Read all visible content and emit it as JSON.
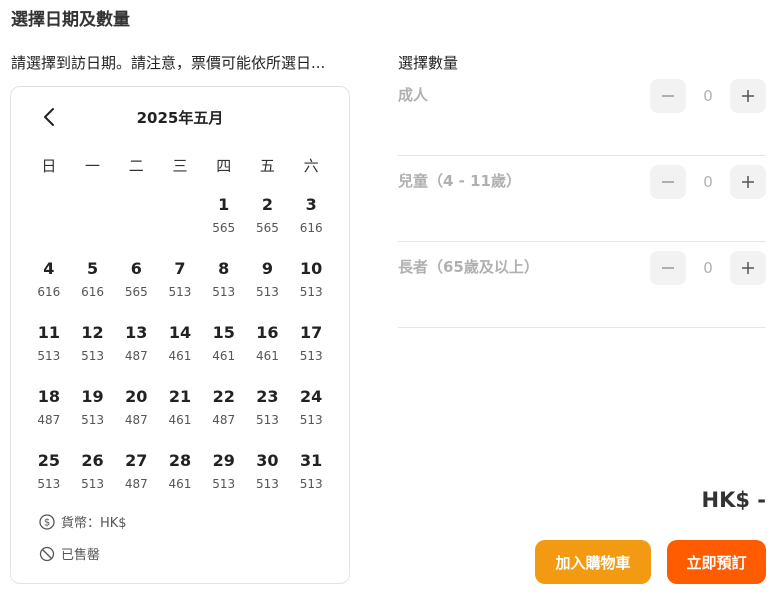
{
  "title": "選擇日期及數量",
  "date_prompt": "請選擇到訪日期。請注意，票價可能依所選日...",
  "calendar": {
    "month_label": "2025年五月",
    "weekdays": [
      "日",
      "一",
      "二",
      "三",
      "四",
      "五",
      "六"
    ],
    "leading_blanks": 4,
    "days": [
      {
        "day": "1",
        "price": "565"
      },
      {
        "day": "2",
        "price": "565"
      },
      {
        "day": "3",
        "price": "616"
      },
      {
        "day": "4",
        "price": "616"
      },
      {
        "day": "5",
        "price": "616"
      },
      {
        "day": "6",
        "price": "565"
      },
      {
        "day": "7",
        "price": "513"
      },
      {
        "day": "8",
        "price": "513"
      },
      {
        "day": "9",
        "price": "513"
      },
      {
        "day": "10",
        "price": "513"
      },
      {
        "day": "11",
        "price": "513"
      },
      {
        "day": "12",
        "price": "513"
      },
      {
        "day": "13",
        "price": "487"
      },
      {
        "day": "14",
        "price": "461"
      },
      {
        "day": "15",
        "price": "461"
      },
      {
        "day": "16",
        "price": "461"
      },
      {
        "day": "17",
        "price": "513"
      },
      {
        "day": "18",
        "price": "487"
      },
      {
        "day": "19",
        "price": "513"
      },
      {
        "day": "20",
        "price": "487"
      },
      {
        "day": "21",
        "price": "461"
      },
      {
        "day": "22",
        "price": "487"
      },
      {
        "day": "23",
        "price": "513"
      },
      {
        "day": "24",
        "price": "513"
      },
      {
        "day": "25",
        "price": "513"
      },
      {
        "day": "26",
        "price": "513"
      },
      {
        "day": "27",
        "price": "487"
      },
      {
        "day": "28",
        "price": "461"
      },
      {
        "day": "29",
        "price": "513"
      },
      {
        "day": "30",
        "price": "513"
      },
      {
        "day": "31",
        "price": "513"
      }
    ],
    "legend": {
      "currency": "貨幣：HK$",
      "sold_out": "已售罄"
    }
  },
  "quantity": {
    "title": "選擇數量",
    "rows": [
      {
        "label": "成人",
        "value": "0"
      },
      {
        "label": "兒童（4 - 11歲）",
        "value": "0"
      },
      {
        "label": "長者（65歲及以上）",
        "value": "0"
      }
    ]
  },
  "total": "HK$ -",
  "buttons": {
    "add_to_cart": "加入購物車",
    "book_now": "立即預訂"
  },
  "colors": {
    "cart_button": "#f29a12",
    "book_button": "#ff5b00"
  }
}
